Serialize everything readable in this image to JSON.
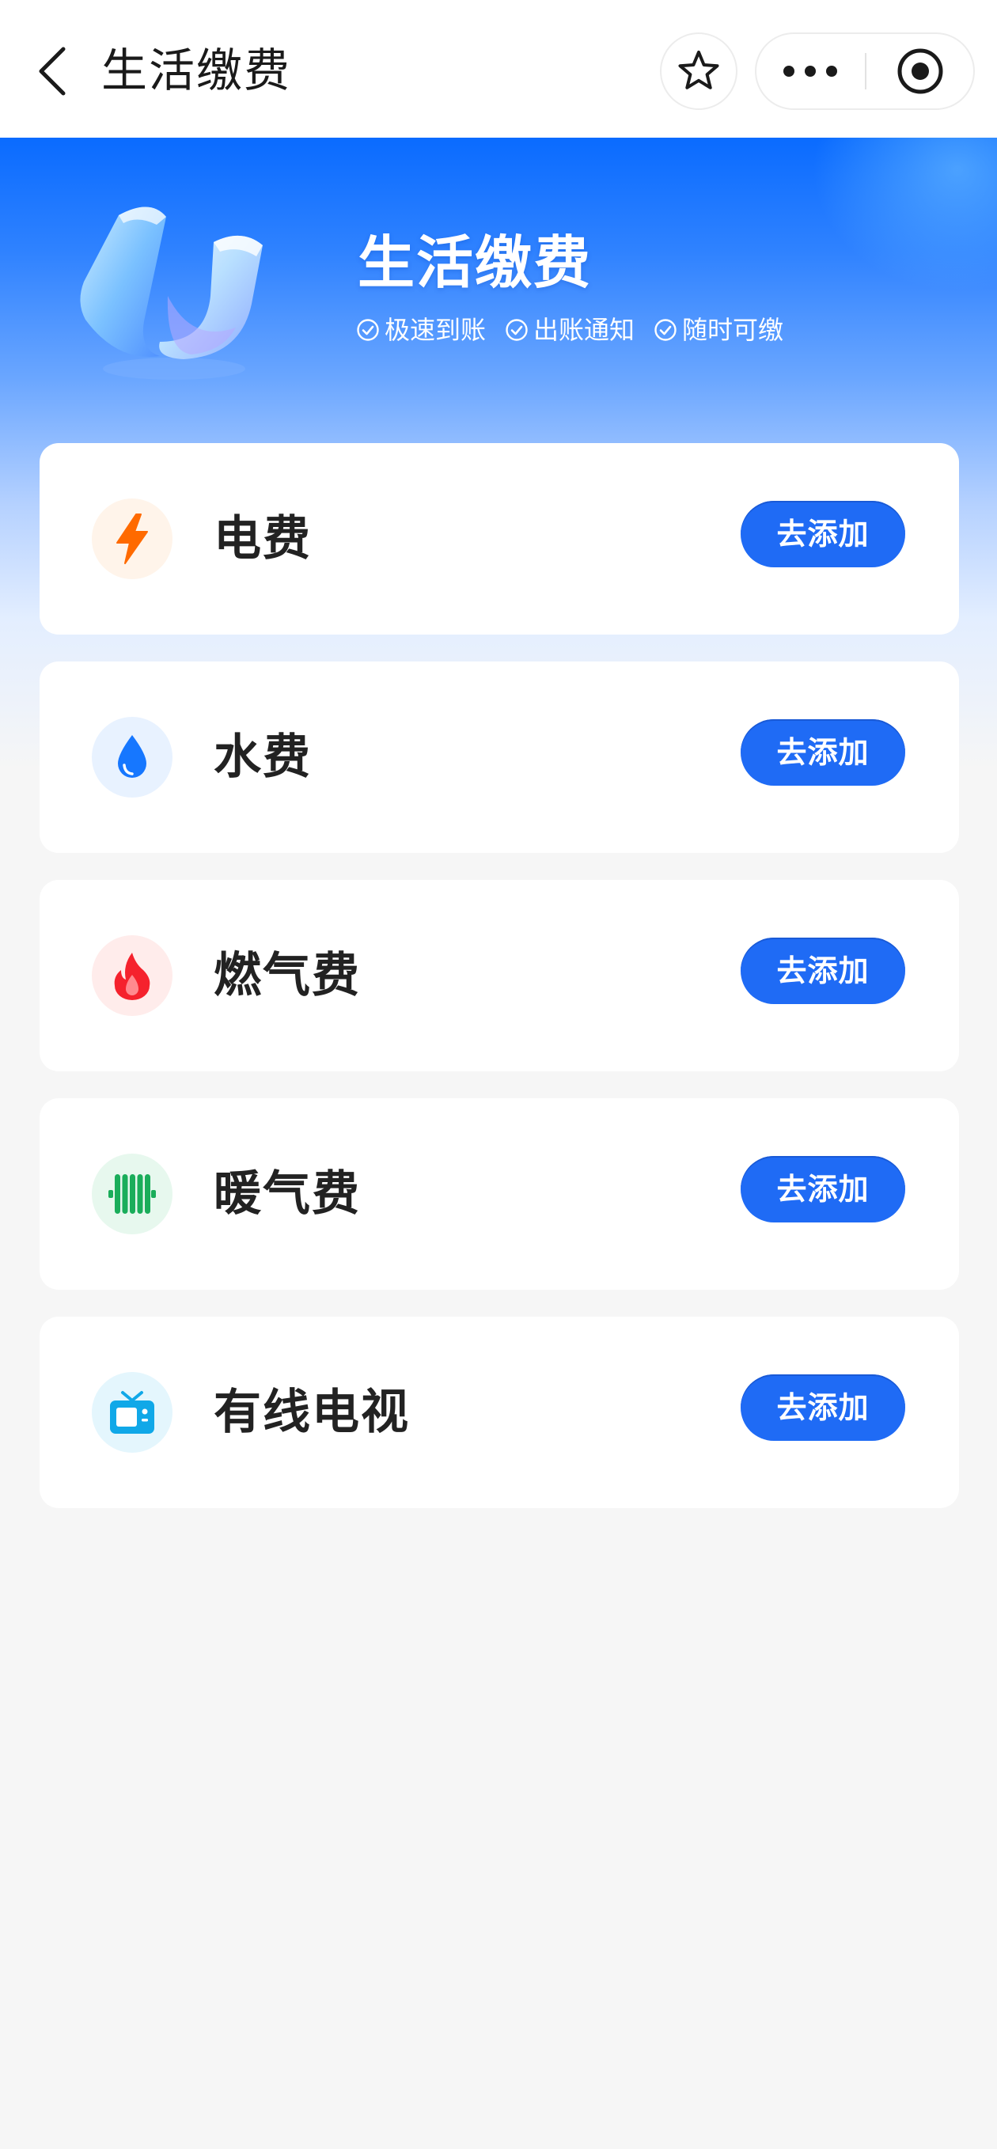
{
  "nav": {
    "title": "生活缴费"
  },
  "hero": {
    "title": "生活缴费",
    "features": [
      "极速到账",
      "出账通知",
      "随时可缴"
    ]
  },
  "colors": {
    "accent": "#1f6bf5",
    "electricity": "#ff6a00",
    "water": "#1677ff",
    "gas": "#f5222d",
    "heating": "#1aad5a",
    "cable_tv": "#10a8e8"
  },
  "bills": [
    {
      "label": "电费",
      "icon": "lightning-icon",
      "button": "去添加"
    },
    {
      "label": "水费",
      "icon": "water-drop-icon",
      "button": "去添加"
    },
    {
      "label": "燃气费",
      "icon": "flame-icon",
      "button": "去添加"
    },
    {
      "label": "暖气费",
      "icon": "radiator-icon",
      "button": "去添加"
    },
    {
      "label": "有线电视",
      "icon": "television-icon",
      "button": "去添加"
    }
  ]
}
